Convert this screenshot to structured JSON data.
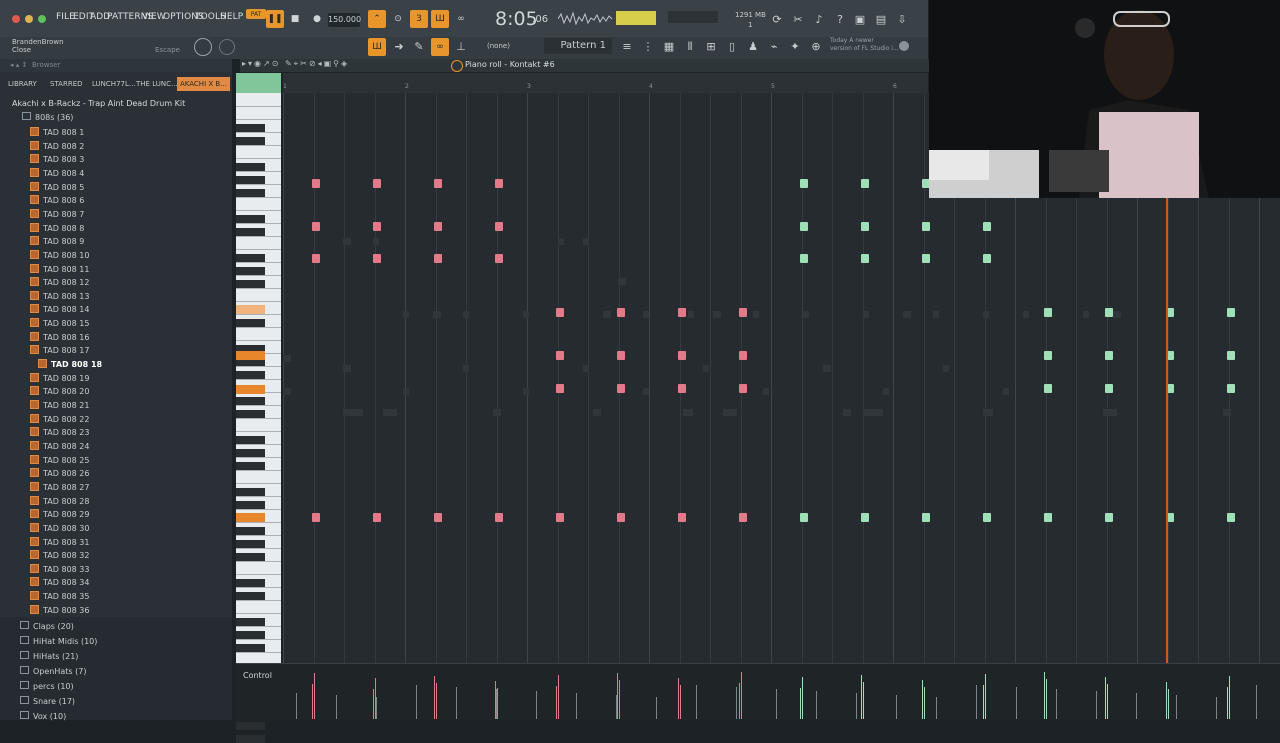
{
  "menu": [
    "FILE",
    "EDIT",
    "ADD",
    "PATTERNS",
    "VIEW",
    "OPTIONS",
    "TOOLS",
    "HELP"
  ],
  "transport": {
    "tempo": "150.000",
    "time": "8:05",
    "time_sub": ":06",
    "cpu": "1291 MB",
    "cpu_sub": "1"
  },
  "user": {
    "name": "BrandenBrown",
    "sub": "Close",
    "hint": "Escape"
  },
  "pattern": {
    "label": "Pattern 1",
    "channel": "(none)"
  },
  "news": {
    "line1": "Today  A newer",
    "line2": "version of FL Studio i..."
  },
  "browser": {
    "label": "Browser",
    "tabs": [
      "LIBRARY",
      "STARRED",
      "LUNCH77L...",
      "THE LUNC...",
      "AKACHI X B..."
    ],
    "kit": "Akachi x B-Rackz - Trap Aint Dead Drum Kit",
    "folder": "808s (36)",
    "files": [
      "TAD 808 1",
      "TAD 808 2",
      "TAD 808 3",
      "TAD 808 4",
      "TAD 808 5",
      "TAD 808 6",
      "TAD 808 7",
      "TAD 808 8",
      "TAD 808 9",
      "TAD 808 10",
      "TAD 808 11",
      "TAD 808 12",
      "TAD 808 13",
      "TAD 808 14",
      "TAD 808 15",
      "TAD 808 16",
      "TAD 808 17",
      "TAD 808 18",
      "TAD 808 19",
      "TAD 808 20",
      "TAD 808 21",
      "TAD 808 22",
      "TAD 808 23",
      "TAD 808 24",
      "TAD 808 25",
      "TAD 808 26",
      "TAD 808 27",
      "TAD 808 28",
      "TAD 808 29",
      "TAD 808 30",
      "TAD 808 31",
      "TAD 808 32",
      "TAD 808 33",
      "TAD 808 34",
      "TAD 808 35",
      "TAD 808 36"
    ],
    "selected_index": 17,
    "folders": [
      "Claps (20)",
      "HiHat Midis (10)",
      "HiHats (21)",
      "OpenHats (7)",
      "percs (10)",
      "Snare (17)",
      "Vox (10)"
    ]
  },
  "piano_roll": {
    "title": "Piano roll - Kontakt #6",
    "bars": [
      "1",
      "2",
      "3",
      "4",
      "5",
      "6"
    ],
    "control_label": "Control",
    "colors": {
      "red_note": "#e27a8a",
      "green_note": "#9fe0b8",
      "playhead": "#d9531e",
      "accent": "#e8962c"
    }
  }
}
